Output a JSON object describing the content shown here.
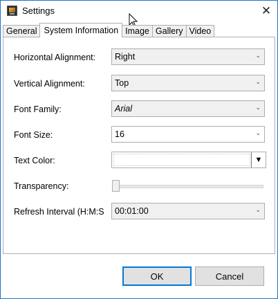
{
  "window": {
    "title": "Settings",
    "close_glyph": "✕"
  },
  "tabs": [
    {
      "label": "General"
    },
    {
      "label": "System Information",
      "active": true
    },
    {
      "label": "Image"
    },
    {
      "label": "Gallery"
    },
    {
      "label": "Video"
    }
  ],
  "form": {
    "horizontal_alignment": {
      "label": "Horizontal Alignment:",
      "value": "Right"
    },
    "vertical_alignment": {
      "label": "Vertical Alignment:",
      "value": "Top"
    },
    "font_family": {
      "label": "Font Family:",
      "value": "Arial"
    },
    "font_size": {
      "label": "Font Size:",
      "value": "16"
    },
    "text_color": {
      "label": "Text Color:",
      "value": ""
    },
    "transparency": {
      "label": "Transparency:",
      "value_fraction": 0.0
    },
    "refresh_interval": {
      "label": "Refresh Interval (H:M:S",
      "value": "00:01:00"
    }
  },
  "icons": {
    "dropdown_arrow": "⌄",
    "color_dropdown_arrow": "▼"
  },
  "buttons": {
    "ok": "OK",
    "cancel": "Cancel"
  },
  "colors": {
    "window_border": "#1f73c9",
    "default_button_border": "#0078d7"
  }
}
